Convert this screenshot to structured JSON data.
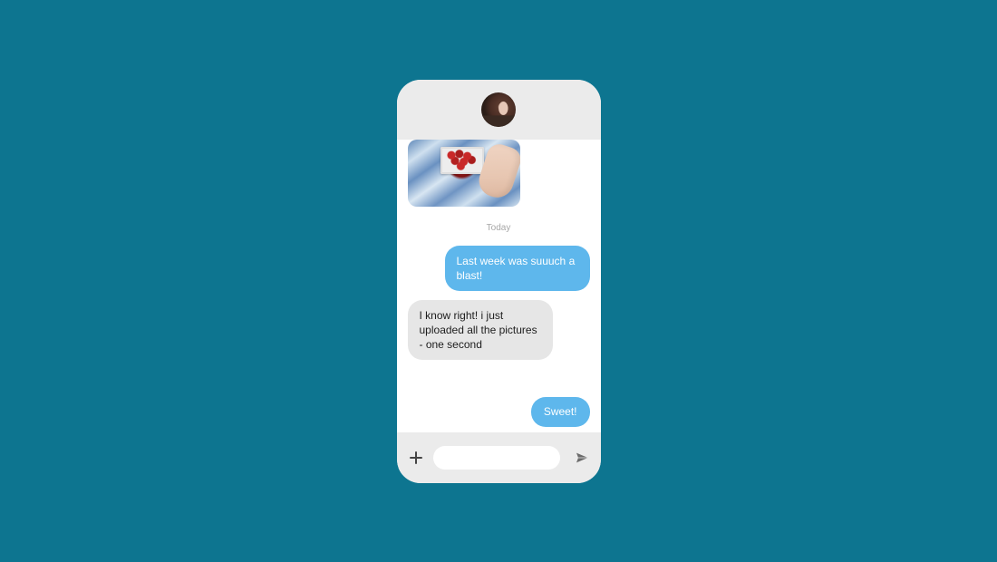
{
  "header": {
    "avatar_name": "contact-avatar"
  },
  "chat": {
    "attachment_name": "photo-attachment",
    "date_label": "Today",
    "messages": [
      {
        "side": "sent",
        "text": "Last week was suuuch a blast!"
      },
      {
        "side": "received",
        "text": "I know right! i just uploaded all the pictures - one second"
      },
      {
        "side": "sent",
        "text": "Sweet!"
      }
    ]
  },
  "composer": {
    "add_icon": "plus-icon",
    "input_placeholder": "",
    "send_icon": "send-icon"
  },
  "colors": {
    "page_bg": "#0d7590",
    "phone_bg": "#ffffff",
    "bar_bg": "#ebebeb",
    "sent_bubble": "#5eb7ec",
    "received_bubble": "#e6e6e6"
  }
}
